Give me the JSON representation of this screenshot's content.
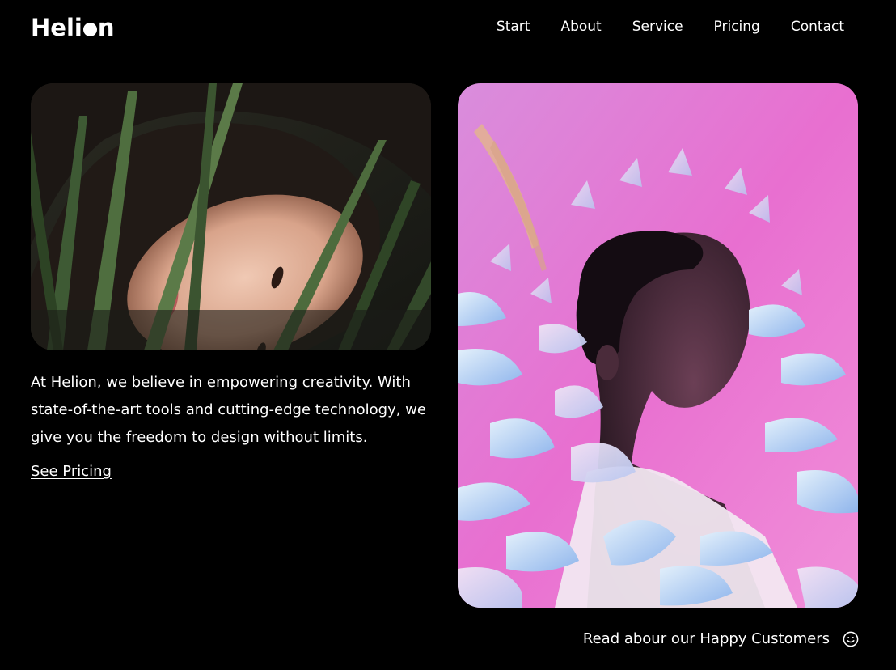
{
  "brand": {
    "name_before_dot": "Heli",
    "name_after_dot": "n"
  },
  "nav": {
    "items": [
      {
        "label": "Start"
      },
      {
        "label": "About"
      },
      {
        "label": "Service"
      },
      {
        "label": "Pricing"
      },
      {
        "label": "Contact"
      }
    ]
  },
  "hero": {
    "left_image": {
      "icon": "photo-woman-among-grass"
    },
    "right_image": {
      "icon": "photo-man-among-pink-flowers"
    },
    "intro_text": "At Helion, we believe in empowering creativity. With state-of-the-art tools and cutting-edge technology, we give you the freedom to design without limits.",
    "cta_label": "See Pricing"
  },
  "footer": {
    "customers_label": "Read abour our Happy Customers",
    "customers_icon": "smiley-icon"
  },
  "colors": {
    "background": "#000000",
    "text": "#ffffff",
    "accent_pink": "#e86fd0"
  }
}
